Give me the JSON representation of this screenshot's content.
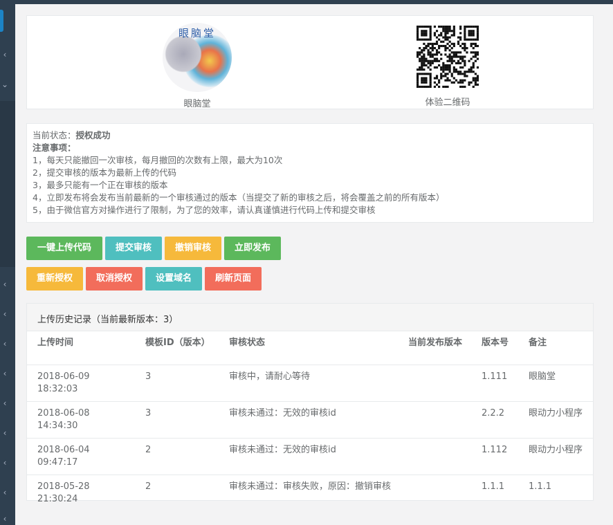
{
  "brand": {
    "logo_text": "眼脑堂",
    "logo_caption": "眼脑堂",
    "qr_caption": "体验二维码"
  },
  "status": {
    "label": "当前状态：",
    "value": "授权成功"
  },
  "notes": {
    "title": "注意事项：",
    "items": [
      "1，每天只能撤回一次审核，每月撤回的次数有上限，最大为10次",
      "2，提交审核的版本为最新上传的代码",
      "3，最多只能有一个正在审核的版本",
      "4，立即发布将会发布当前最新的一个审核通过的版本（当提交了新的审核之后，将会覆盖之前的所有版本）",
      "5，由于微信官方对操作进行了限制，为了您的效率，请认真谨慎进行代码上传和提交审核"
    ]
  },
  "actions": {
    "upload": "一键上传代码",
    "submit": "提交审核",
    "withdraw": "撤销审核",
    "publish": "立即发布",
    "reauth": "重新授权",
    "cancel_auth": "取消授权",
    "domain": "设置域名",
    "refresh": "刷新页面"
  },
  "colors": {
    "green": "#5cb85c",
    "teal": "#4fbfbf",
    "yellow": "#f6b93b",
    "red": "#f26d5b",
    "sidebar": "#2f4050"
  },
  "history": {
    "title": "上传历史记录（当前最新版本：3）",
    "columns": [
      "上传时间",
      "模板ID（版本）",
      "审核状态",
      "当前发布版本",
      "版本号",
      "备注"
    ],
    "rows": [
      {
        "time": "2018-06-09 18:32:03",
        "template": "3",
        "status": "审核中，请耐心等待",
        "current": "",
        "version": "1.111",
        "remark": "眼脑堂"
      },
      {
        "time": "2018-06-08 14:34:30",
        "template": "3",
        "status": "审核未通过：无效的审核id",
        "current": "",
        "version": "2.2.2",
        "remark": "眼动力小程序"
      },
      {
        "time": "2018-06-04 09:47:17",
        "template": "2",
        "status": "审核未通过：无效的审核id",
        "current": "",
        "version": "1.112",
        "remark": "眼动力小程序"
      },
      {
        "time": "2018-05-28 21:30:24",
        "template": "2",
        "status": "审核未通过：审核失败，原因：撤销审核",
        "current": "",
        "version": "1.1.1",
        "remark": "1.1.1"
      }
    ]
  },
  "sidebar": {
    "chevron_icons": [
      "chevron-left-icon",
      "chevron-down-icon"
    ]
  }
}
